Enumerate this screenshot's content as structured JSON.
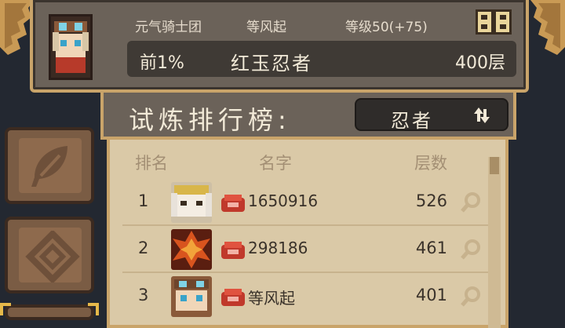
{
  "player": {
    "guild": "元气骑士团",
    "name": "等风起",
    "level_text": "等级50(+75)",
    "rank_percent": "前1%",
    "class_name": "红玉忍者",
    "floors": "400层"
  },
  "title": "试炼排行榜:",
  "filter": {
    "label": "忍者"
  },
  "columns": {
    "rank": "排名",
    "name": "名字",
    "floors": "层数"
  },
  "rows": [
    {
      "rank": "1",
      "name": "1650916",
      "floors": "526"
    },
    {
      "rank": "2",
      "name": "298186",
      "floors": "461"
    },
    {
      "rank": "3",
      "name": "等风起",
      "floors": "401"
    }
  ],
  "icons": {
    "gift": "gift-icon",
    "refresh": "refresh-icon",
    "leaf": "leaf-icon",
    "diamond": "diamond-icon",
    "search": "search-icon",
    "badge": "crown-badge-icon"
  },
  "colors": {
    "accent": "#c9a46a",
    "panel": "#6b6259",
    "board": "#dac9a7",
    "badge": "#c0392b"
  }
}
